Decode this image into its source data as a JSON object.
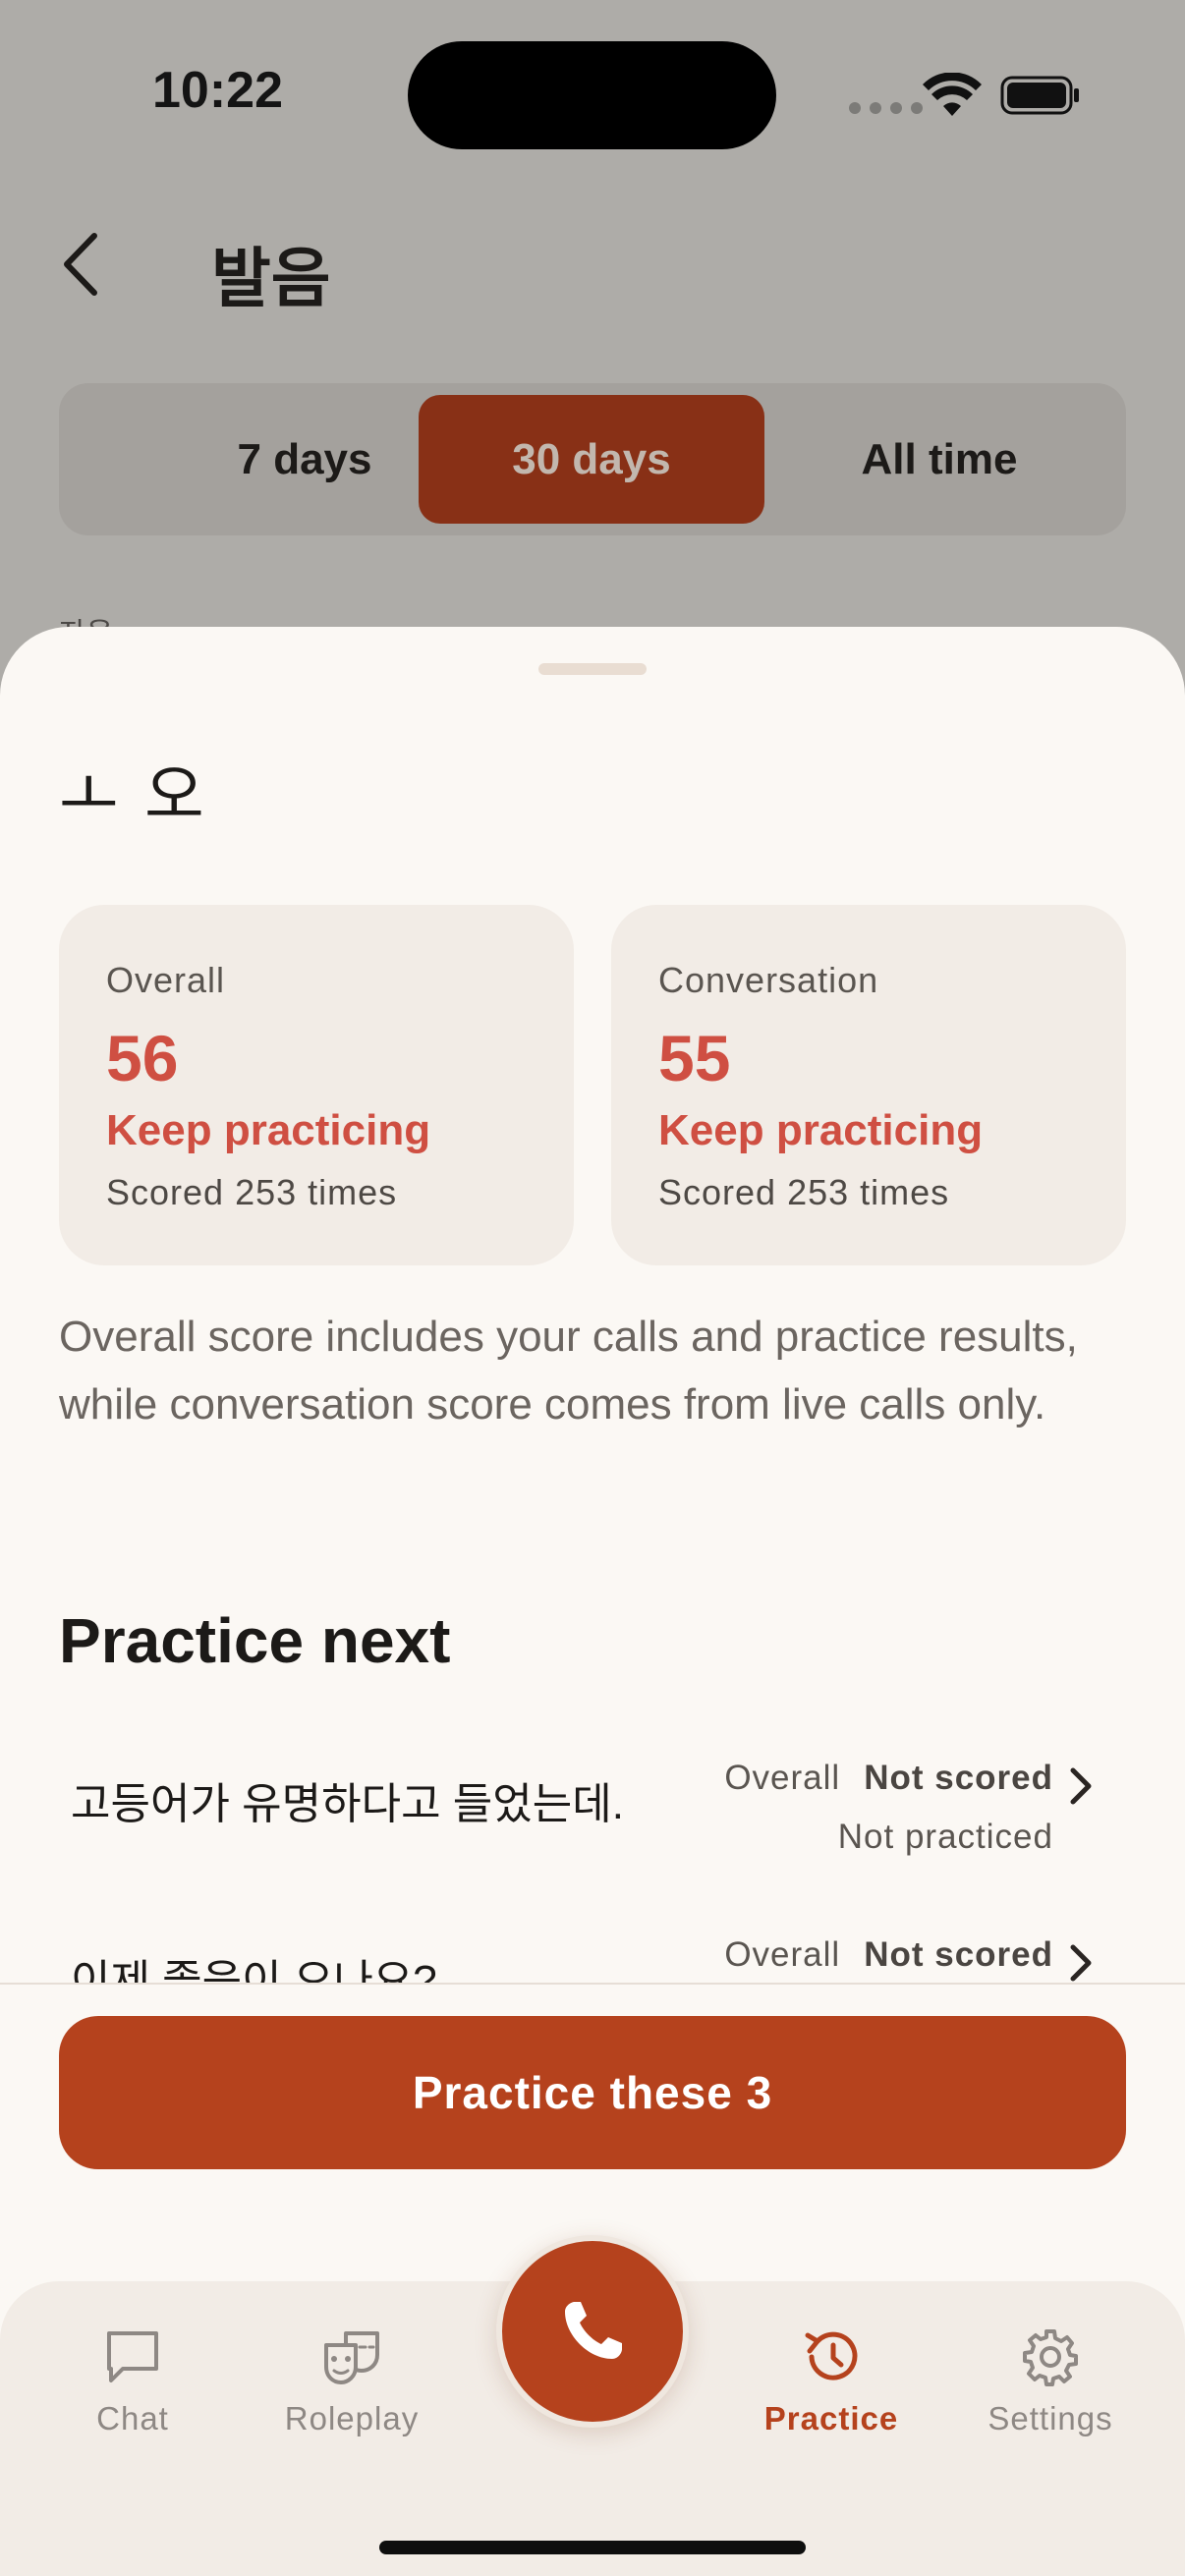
{
  "status_bar": {
    "time": "10:22"
  },
  "header": {
    "title": "발음"
  },
  "range_tabs": {
    "items": [
      "7 days",
      "30 days",
      "All time"
    ],
    "selected": "30 days"
  },
  "background_peek_label": "자음",
  "sheet": {
    "title": "ㅗ  오",
    "cards": [
      {
        "label": "Overall",
        "score": "56",
        "status": "Keep practicing",
        "count": "Scored 253 times"
      },
      {
        "label": "Conversation",
        "score": "55",
        "status": "Keep practicing",
        "count": "Scored 253 times"
      }
    ],
    "explanation": "Overall score includes your calls and practice results, while conversation score comes from live calls only.",
    "section_title": "Practice next",
    "items": [
      {
        "text": "고등어가 유명하다고 들었는데.",
        "meta_label": "Overall",
        "meta_value": "Not scored",
        "meta_sub": "Not practiced"
      },
      {
        "text": "이제 졸음이 오나요?",
        "meta_label": "Overall",
        "meta_value": "Not scored",
        "meta_sub": ""
      }
    ],
    "cta_label": "Practice these 3"
  },
  "tabbar": {
    "items": [
      {
        "label": "Chat",
        "icon": "chat-bubble-icon"
      },
      {
        "label": "Roleplay",
        "icon": "masks-icon"
      },
      {
        "label": "Practice",
        "icon": "history-icon",
        "active": true
      },
      {
        "label": "Settings",
        "icon": "gear-icon"
      }
    ],
    "call_icon": "phone-icon"
  },
  "colors": {
    "accent": "#b5421d",
    "score": "#cf4f42",
    "sheet_bg": "#fbf8f4",
    "card_bg": "#f2ece6"
  }
}
